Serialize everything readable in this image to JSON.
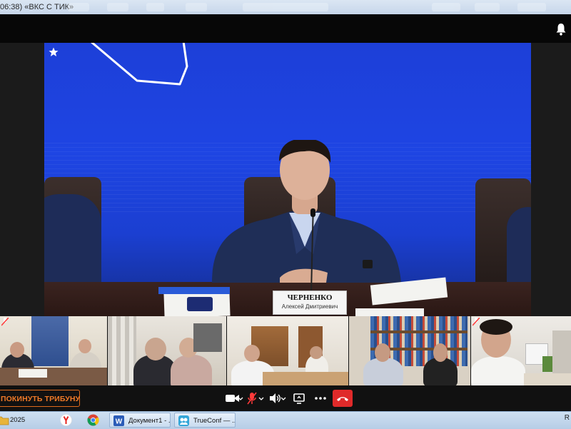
{
  "window": {
    "title": "06:38) «ВКС С ТИК»"
  },
  "stage": {
    "nameplate": {
      "surname": "ЧЕРНЕНКО",
      "given_names": "Алексей Дмитриевич"
    }
  },
  "controls": {
    "leave_label": "ПОКИНУТЬ ТРИБУНУ",
    "hangup_color": "#e02a2a",
    "accent": "#f07a28"
  },
  "taskbar": {
    "items": [
      {
        "label": "2025",
        "icon": "folder-icon"
      },
      {
        "label": "",
        "icon": "yandex-browser-icon"
      },
      {
        "label": "",
        "icon": "chrome-icon"
      },
      {
        "label": "Документ1 - ...",
        "icon": "word-icon"
      },
      {
        "label": "TrueConf — ...",
        "icon": "trueconf-icon"
      }
    ],
    "tray_text": "R"
  }
}
